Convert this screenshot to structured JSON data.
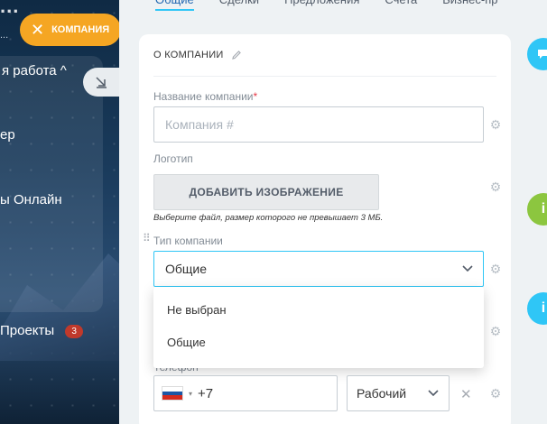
{
  "sidebar": {
    "logo": "...",
    "logo_sub": "...",
    "items": [
      {
        "label": "я работа ^"
      },
      {
        "label": "ер"
      },
      {
        "label": "ы Онлайн"
      },
      {
        "label": "Проекты",
        "badge": "3"
      }
    ]
  },
  "company_pill": {
    "label": "КОМПАНИЯ",
    "close": "✕"
  },
  "tabs": [
    {
      "label": "Общие"
    },
    {
      "label": "Сделки"
    },
    {
      "label": "Предложения"
    },
    {
      "label": "Счета"
    },
    {
      "label": "Бизнес-пр"
    }
  ],
  "card": {
    "title": "О КОМПАНИИ",
    "name_label": "Название компании",
    "name_required": "*",
    "name_placeholder": "Компания #",
    "logo_label": "Логотип",
    "add_image_label": "ДОБАВИТЬ ИЗОБРАЖЕНИЕ",
    "hint": "Выберите файл, размер которого не превышает 3 МБ.",
    "type_label": "Тип компании",
    "type_value": "Общие",
    "dropdown_options": [
      "Не выбран",
      "Общие"
    ],
    "phone_label": "Телефон",
    "phone_value": "+7",
    "phone_type": "Рабочий"
  },
  "colors": {
    "accent": "#2fc6f6",
    "pill": "#f5a623",
    "info_green": "#8cc63f",
    "info_blue": "#2fc6f6"
  }
}
